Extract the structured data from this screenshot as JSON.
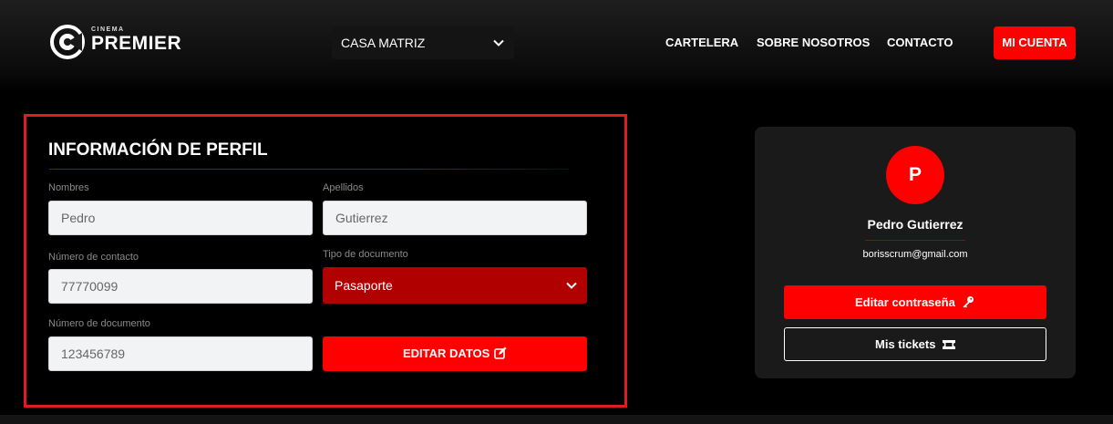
{
  "header": {
    "logo": {
      "small": "CINEMA",
      "big": "PREMIER"
    },
    "branch_select": {
      "value": "CASA MATRIZ"
    },
    "nav": [
      "CARTELERA",
      "SOBRE NOSOTROS",
      "CONTACTO"
    ],
    "account_button": "MI CUENTA"
  },
  "profile_form": {
    "title": "INFORMACIÓN DE PERFIL",
    "first_name": {
      "label": "Nombres",
      "value": "Pedro"
    },
    "last_name": {
      "label": "Apellidos",
      "value": "Gutierrez"
    },
    "phone": {
      "label": "Número de contacto",
      "value": "77770099"
    },
    "doc_type": {
      "label": "Tipo de documento",
      "value": "Pasaporte"
    },
    "doc_number": {
      "label": "Número de documento",
      "value": "123456789"
    },
    "edit_button": "EDITAR DATOS"
  },
  "user_card": {
    "avatar_letter": "P",
    "name": "Pedro Gutierrez",
    "email": "borisscrum@gmail.com",
    "change_password_button": "Editar contraseña",
    "tickets_button": "Mis tickets"
  },
  "colors": {
    "accent": "#ff0000",
    "panel_border": "#e01b24",
    "select_bg": "#b00000",
    "card_bg": "#1a1a1a"
  },
  "icons": {
    "logo": "cinema-reel-logo-icon",
    "select_chevron": "chevron-down-icon",
    "edit": "edit-square-icon",
    "password": "key-icon",
    "tickets": "ticket-icon"
  }
}
